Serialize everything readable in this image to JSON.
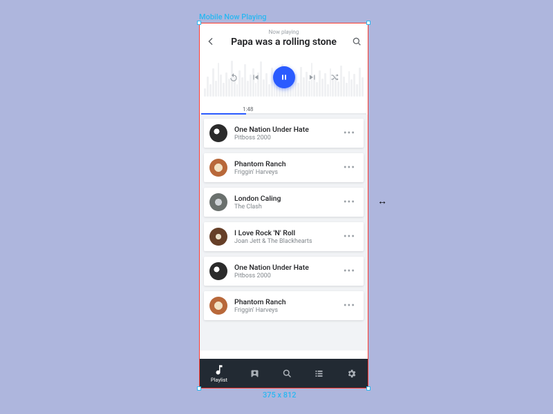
{
  "designer": {
    "frame_label": "Mobile Now Playing",
    "dimensions_label": "375 x 812"
  },
  "header": {
    "subtitle": "Now playing",
    "title": "Papa was a rolling stone"
  },
  "playback": {
    "current_time": "1:48"
  },
  "tracks": [
    {
      "title": "One Nation Under Hate",
      "artist": "Pitboss 2000"
    },
    {
      "title": "Phantom Ranch",
      "artist": "Friggin' Harveys"
    },
    {
      "title": "London Caling",
      "artist": "The Clash"
    },
    {
      "title": "I Love Rock 'N' Roll",
      "artist": "Joan Jett & The Blackhearts"
    },
    {
      "title": "One Nation Under Hate",
      "artist": "Pitboss 2000"
    },
    {
      "title": "Phantom Ranch",
      "artist": "Friggin' Harveys"
    }
  ],
  "nav": {
    "items": [
      {
        "label": "Playlist"
      },
      {
        "label": ""
      },
      {
        "label": ""
      },
      {
        "label": ""
      },
      {
        "label": ""
      }
    ]
  }
}
